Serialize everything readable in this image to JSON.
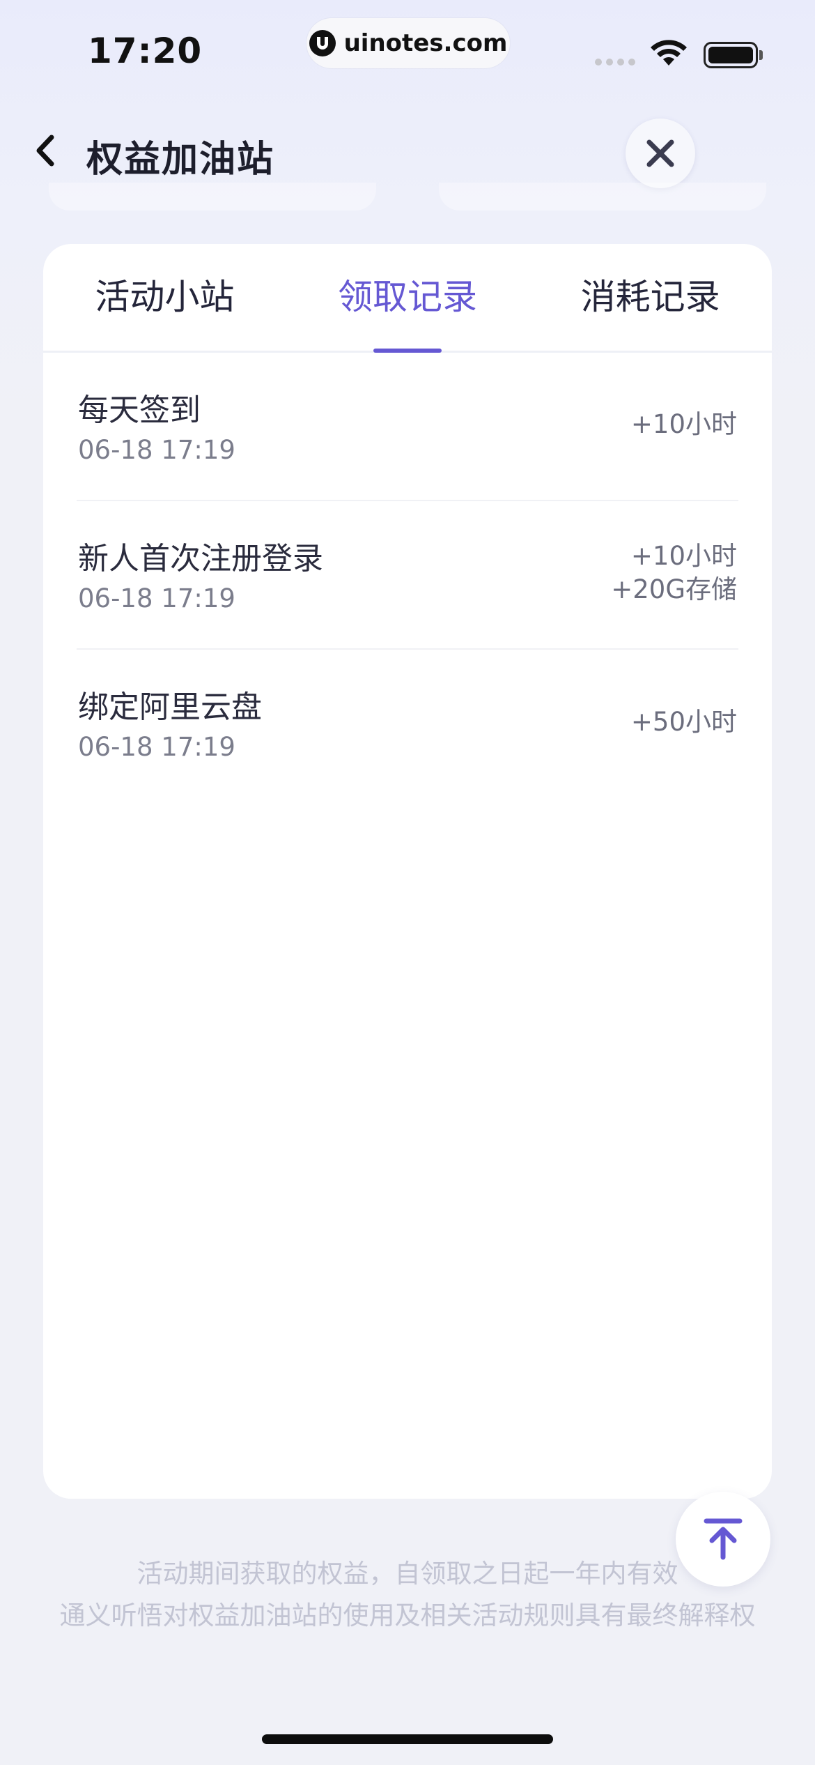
{
  "status_bar": {
    "time": "17:20",
    "watermark": "uinotes.com"
  },
  "header": {
    "title": "权益加油站",
    "back_icon": "chevron-left-icon",
    "close_icon": "close-icon"
  },
  "tabs": [
    {
      "label": "活动小站",
      "active": false
    },
    {
      "label": "领取记录",
      "active": true
    },
    {
      "label": "消耗记录",
      "active": false
    }
  ],
  "records": [
    {
      "title": "每天签到",
      "date": "06-18 17:19",
      "rewards": [
        "+10小时"
      ]
    },
    {
      "title": "新人首次注册登录",
      "date": "06-18 17:19",
      "rewards": [
        "+10小时",
        "+20G存储"
      ]
    },
    {
      "title": "绑定阿里云盘",
      "date": "06-18 17:19",
      "rewards": [
        "+50小时"
      ]
    }
  ],
  "footer": {
    "line1": "活动期间获取的权益，自领取之日起一年内有效",
    "line2": "通义听悟对权益加油站的使用及相关活动规则具有最终解释权"
  },
  "colors": {
    "accent": "#6558d3",
    "background": "#f0f1f7",
    "card": "#ffffff"
  }
}
